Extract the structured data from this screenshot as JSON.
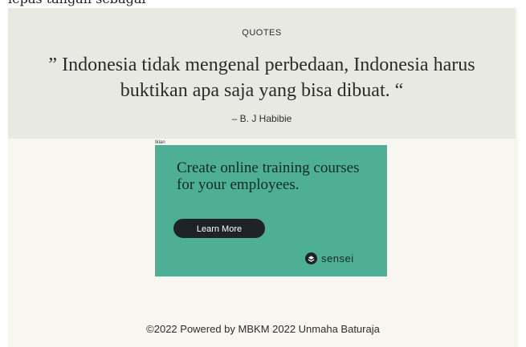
{
  "top_fragment": "lepas tangan sebagai",
  "quotes": {
    "title": "QUOTES",
    "text": "” Indonesia tidak mengenal perbedaan, Indonesia harus buktikan apa saja yang bisa dibuat. “",
    "author": "– B. J Habibie"
  },
  "ad": {
    "label": "Iklan",
    "headline": "Create online training courses for your employees.",
    "button_label": "Learn More",
    "brand": "sensei",
    "brand_icon": "sensei-logo-icon",
    "background": "#4fae96"
  },
  "footer": {
    "text": "©2022 Powered by MBKM 2022 Unmaha Baturaja"
  }
}
